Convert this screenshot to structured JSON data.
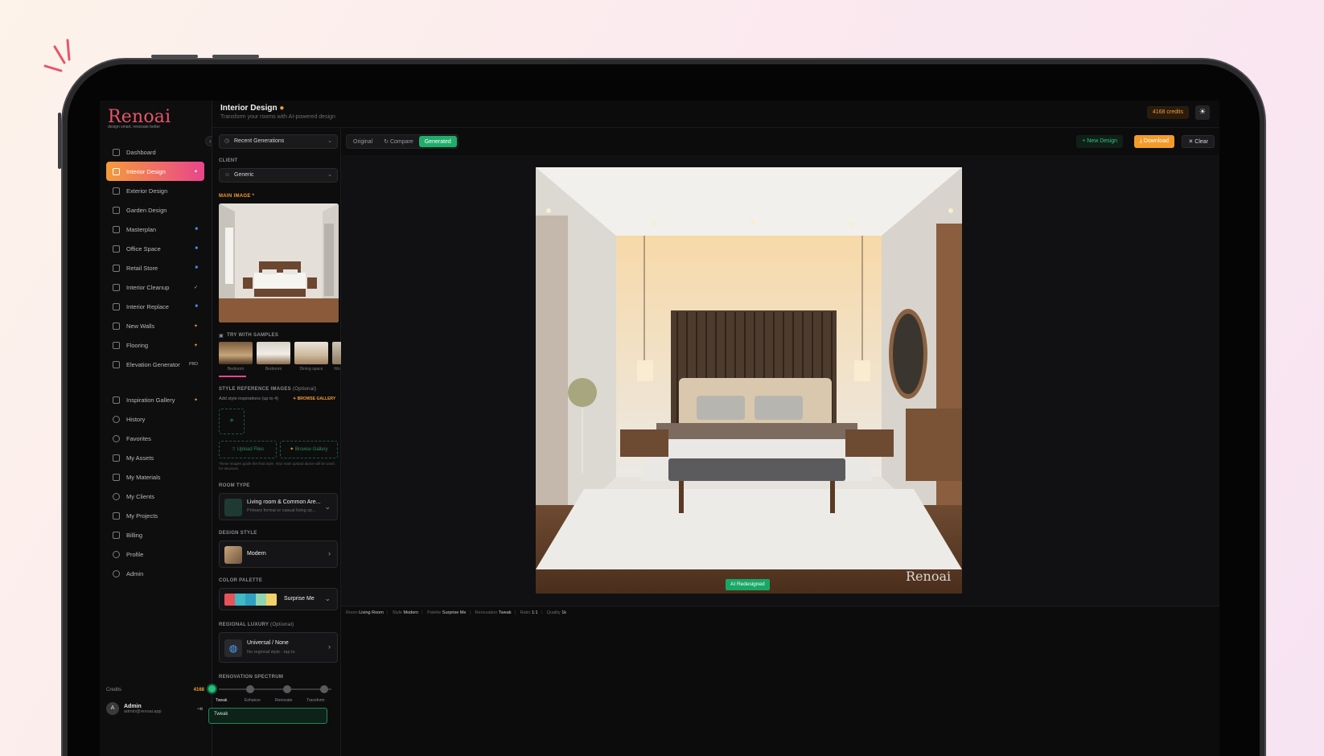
{
  "app": {
    "logo_text": "Renoai",
    "tagline": "design smart. renovate better"
  },
  "header": {
    "title": "Interior Design",
    "subtitle": "Transform your rooms with AI-powered design",
    "credits_badge": "4168 credits",
    "theme_icon": "sun-icon"
  },
  "sidebar": {
    "items": [
      {
        "label": "Dashboard",
        "tag": ""
      },
      {
        "label": "Interior Design",
        "tag": "✦",
        "active": true
      },
      {
        "label": "Exterior Design",
        "tag": ""
      },
      {
        "label": "Garden Design",
        "tag": ""
      },
      {
        "label": "Masterplan",
        "tag": "■"
      },
      {
        "label": "Office Space",
        "tag": "■"
      },
      {
        "label": "Retail Store",
        "tag": "■"
      },
      {
        "label": "Interior Cleanup",
        "tag": "✓"
      },
      {
        "label": "Interior Replace",
        "tag": "■"
      },
      {
        "label": "New Walls",
        "tag": "✦"
      },
      {
        "label": "Flooring",
        "tag": "✦"
      },
      {
        "label": "Elevation Generator",
        "tag": "PRO"
      }
    ],
    "items2": [
      {
        "label": "Inspiration Gallery",
        "tag": "✦"
      },
      {
        "label": "History",
        "tag": ""
      },
      {
        "label": "Favorites",
        "tag": ""
      },
      {
        "label": "My Assets",
        "tag": ""
      },
      {
        "label": "My Materials",
        "tag": ""
      },
      {
        "label": "My Clients",
        "tag": ""
      },
      {
        "label": "My Projects",
        "tag": ""
      },
      {
        "label": "Billing",
        "tag": ""
      },
      {
        "label": "Profile",
        "tag": ""
      },
      {
        "label": "Admin",
        "tag": ""
      }
    ],
    "credits_label": "Credits",
    "credits_value": "4168",
    "user_initial": "A",
    "user_name": "Admin",
    "user_email": "admin@renoai.app"
  },
  "panel": {
    "recent": "Recent Generations",
    "client_label": "CLIENT",
    "client_value": "Generic",
    "main_image_label": "MAIN IMAGE *",
    "samples_label": "TRY WITH SAMPLES",
    "samples": [
      "Bedroom",
      "Bedroom",
      "Dining space",
      "Wo"
    ],
    "style_ref_label": "STYLE REFERENCE IMAGES",
    "style_ref_optional": "(Optional)",
    "style_ref_hint": "Add style inspirations (up to 4)",
    "browse_gallery_link": "BROWSE GALLERY",
    "upload_files": "Upload Files",
    "browse_gallery": "Browse Gallery",
    "style_ref_note": "These images guide the final style. Your main upload above will be used for structure.",
    "room_type_label": "ROOM TYPE",
    "room_type_title": "Living room & Common Are...",
    "room_type_sub": "Primary formal or casual living sp...",
    "design_style_label": "DESIGN STYLE",
    "design_style_value": "Modern",
    "palette_label": "COLOR PALETTE",
    "palette_value": "Surprise Me",
    "palette_colors": [
      "#e8525a",
      "#3fb9c4",
      "#2f9fc2",
      "#8fd6b0",
      "#f2d36b"
    ],
    "regional_label": "REGIONAL LUXURY",
    "regional_optional": "(Optional)",
    "regional_title": "Universal / None",
    "regional_sub": "No regional style - tap to",
    "spectrum_label": "RENOVATION SPECTRUM",
    "spectrum_stops": [
      "Tweak",
      "Enhance",
      "Renovate",
      "Transform"
    ],
    "spectrum_level": 0,
    "tweak_box": "Tweak"
  },
  "toolbar": {
    "tabs": [
      "Original",
      "Compare",
      "Generated"
    ],
    "active_tab": "Generated",
    "new_design": "New Design",
    "download": "Download",
    "clear": "Clear"
  },
  "canvas": {
    "watermark": "Renoai",
    "badge": "AI Redesigned"
  },
  "meta": {
    "room_label": "Room",
    "room": "Living Room",
    "style_label": "Style",
    "style": "Modern",
    "palette_label": "Palette",
    "palette": "Surprise Me",
    "renovation_label": "Renovation",
    "renovation": "Tweak",
    "ratio_label": "Ratio",
    "ratio": "1:1",
    "quality_label": "Quality",
    "quality": "1k"
  }
}
